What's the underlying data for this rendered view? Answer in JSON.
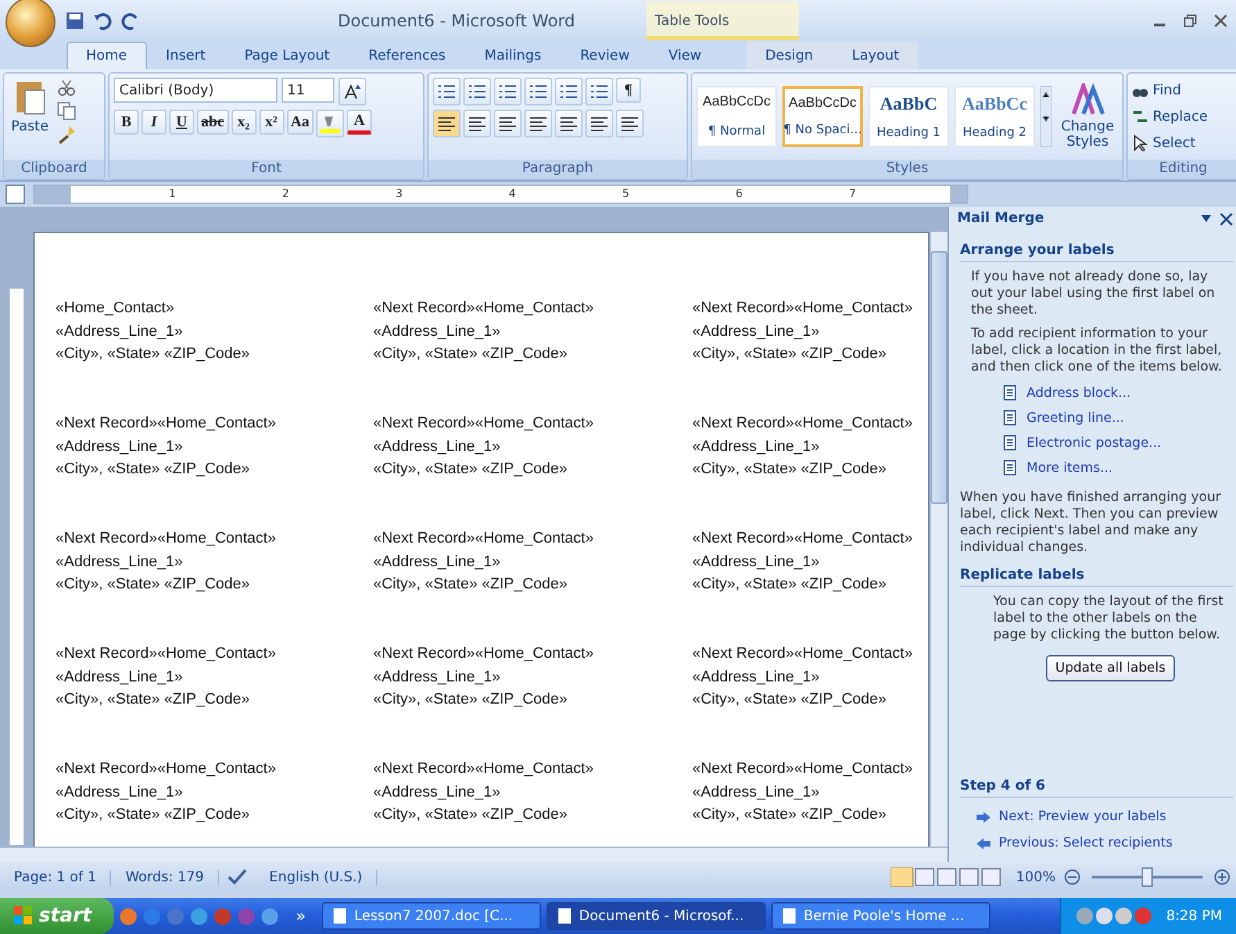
{
  "title_bar": {
    "title": "Document6 - Microsoft Word",
    "contextual_group": "Table Tools"
  },
  "tabs": [
    {
      "label": "Home",
      "selected": true,
      "contextual": false
    },
    {
      "label": "Insert",
      "selected": false,
      "contextual": false
    },
    {
      "label": "Page Layout",
      "selected": false,
      "contextual": false
    },
    {
      "label": "References",
      "selected": false,
      "contextual": false
    },
    {
      "label": "Mailings",
      "selected": false,
      "contextual": false
    },
    {
      "label": "Review",
      "selected": false,
      "contextual": false
    },
    {
      "label": "View",
      "selected": false,
      "contextual": false
    },
    {
      "label": "Design",
      "selected": false,
      "contextual": true
    },
    {
      "label": "Layout",
      "selected": false,
      "contextual": true
    }
  ],
  "ribbon": {
    "clipboard": {
      "label": "Clipboard",
      "paste": "Paste"
    },
    "font": {
      "label": "Font",
      "font_name": "Calibri (Body)",
      "font_size": "11",
      "format_buttons": [
        "B",
        "I",
        "U",
        "abc",
        "x₂",
        "x²",
        "Aa"
      ],
      "color_button": "A"
    },
    "paragraph": {
      "label": "Paragraph",
      "pilcrow": "¶"
    },
    "styles": {
      "label": "Styles",
      "items": [
        {
          "preview": "AaBbCcDc",
          "name": "¶ Normal",
          "kind": "body",
          "selected": false
        },
        {
          "preview": "AaBbCcDc",
          "name": "¶ No Spaci...",
          "kind": "body",
          "selected": true
        },
        {
          "preview": "AaBbC",
          "name": "Heading 1",
          "kind": "heading1",
          "selected": false
        },
        {
          "preview": "AaBbCc",
          "name": "Heading 2",
          "kind": "heading2",
          "selected": false
        }
      ],
      "change_styles": "Change Styles"
    },
    "editing": {
      "label": "Editing",
      "items": [
        {
          "label": "Find",
          "kind": "find"
        },
        {
          "label": "Replace",
          "kind": "replace"
        },
        {
          "label": "Select",
          "kind": "select"
        }
      ]
    }
  },
  "ruler": {
    "marks": [
      "1",
      "2",
      "3",
      "4",
      "5",
      "6",
      "7"
    ]
  },
  "document": {
    "labels": [
      {
        "lines": [
          "«Home_Contact»",
          "«Address_Line_1»",
          "«City», «State» «ZIP_Code»"
        ]
      },
      {
        "lines": [
          "«Next Record»«Home_Contact»",
          "«Address_Line_1»",
          "«City», «State» «ZIP_Code»"
        ]
      },
      {
        "lines": [
          "«Next Record»«Home_Contact»",
          "«Address_Line_1»",
          "«City», «State» «ZIP_Code»"
        ]
      },
      {
        "lines": [
          "«Next Record»«Home_Contact»",
          "«Address_Line_1»",
          "«City», «State» «ZIP_Code»"
        ]
      },
      {
        "lines": [
          "«Next Record»«Home_Contact»",
          "«Address_Line_1»",
          "«City», «State» «ZIP_Code»"
        ]
      },
      {
        "lines": [
          "«Next Record»«Home_Contact»",
          "«Address_Line_1»",
          "«City», «State» «ZIP_Code»"
        ]
      },
      {
        "lines": [
          "«Next Record»«Home_Contact»",
          "«Address_Line_1»",
          "«City», «State» «ZIP_Code»"
        ]
      },
      {
        "lines": [
          "«Next Record»«Home_Contact»",
          "«Address_Line_1»",
          "«City», «State» «ZIP_Code»"
        ]
      },
      {
        "lines": [
          "«Next Record»«Home_Contact»",
          "«Address_Line_1»",
          "«City», «State» «ZIP_Code»"
        ]
      },
      {
        "lines": [
          "«Next Record»«Home_Contact»",
          "«Address_Line_1»",
          "«City», «State» «ZIP_Code»"
        ]
      },
      {
        "lines": [
          "«Next Record»«Home_Contact»",
          "«Address_Line_1»",
          "«City», «State» «ZIP_Code»"
        ]
      },
      {
        "lines": [
          "«Next Record»«Home_Contact»",
          "«Address_Line_1»",
          "«City», «State» «ZIP_Code»"
        ]
      },
      {
        "lines": [
          "«Next Record»«Home_Contact»",
          "«Address_Line_1»",
          "«City», «State» «ZIP_Code»"
        ]
      },
      {
        "lines": [
          "«Next Record»«Home_Contact»",
          "«Address_Line_1»",
          "«City», «State» «ZIP_Code»"
        ]
      },
      {
        "lines": [
          "«Next Record»«Home_Contact»",
          "«Address_Line_1»",
          "«City», «State» «ZIP_Code»"
        ]
      }
    ]
  },
  "task_pane": {
    "title": "Mail Merge",
    "arrange": {
      "heading": "Arrange your labels",
      "paragraphs": [
        "If you have not already done so, lay out your label using the first label on the sheet.",
        "To add recipient information to your label, click a location in the first label, and then click one of the items below."
      ],
      "links": [
        "Address block...",
        "Greeting line...",
        "Electronic postage...",
        "More items..."
      ],
      "closing": "When you have finished arranging your label, click Next. Then you can preview each recipient's label and make any individual changes."
    },
    "replicate": {
      "heading": "Replicate labels",
      "paragraph": "You can copy the layout of the first label to the other labels on the page by clicking the button below.",
      "button": "Update all labels"
    },
    "step": {
      "heading": "Step 4 of 6",
      "nav": [
        {
          "label": "Next: Preview your labels",
          "kind": "next"
        },
        {
          "label": "Previous: Select recipients",
          "kind": "previous"
        }
      ]
    }
  },
  "status_bar": {
    "page": "Page: 1 of 1",
    "words": "Words: 179",
    "language": "English (U.S.)",
    "zoom": "100%",
    "zoom_slider": {
      "level": 0.5
    }
  },
  "taskbar": {
    "start": "start",
    "more": "»",
    "windows": [
      {
        "label": "Lesson7 2007.doc [C...",
        "selected": false
      },
      {
        "label": "Document6 - Microsof...",
        "selected": true
      },
      {
        "label": "Bernie Poole's Home ...",
        "selected": false
      }
    ],
    "clock": "8:28 PM"
  }
}
